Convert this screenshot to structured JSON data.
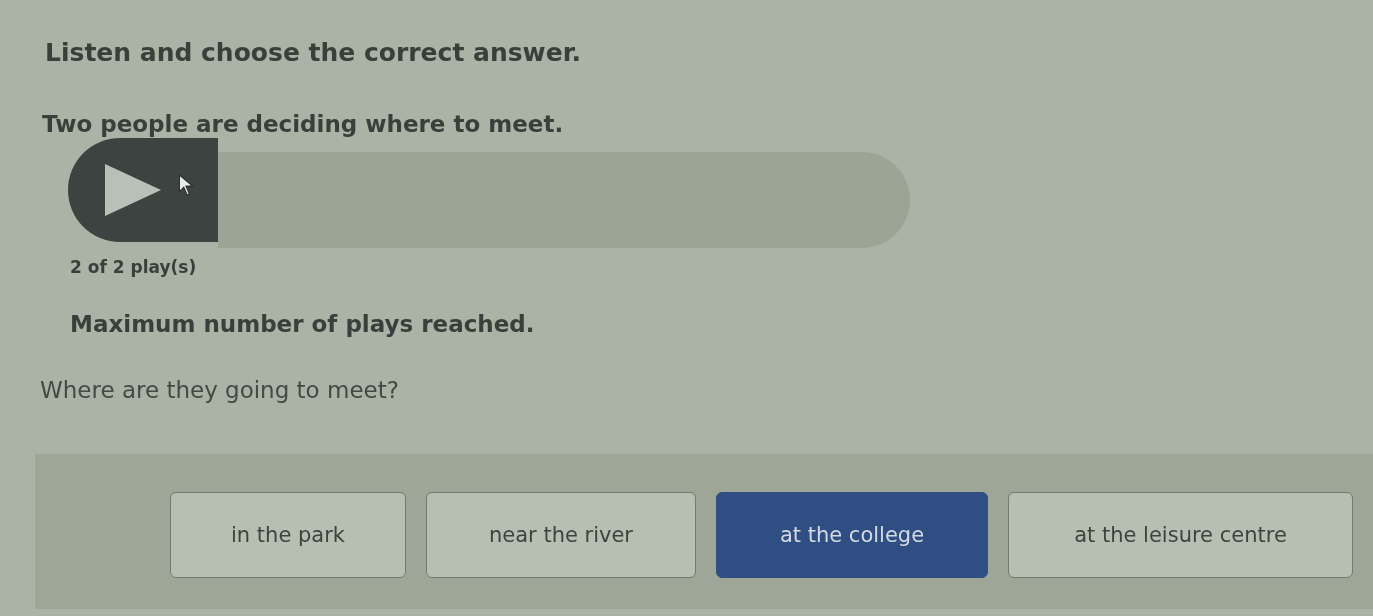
{
  "instruction": "Listen and choose the correct answer.",
  "context": "Two people are deciding where to meet.",
  "audio_player": {
    "play_count": "2 of 2 play(s)",
    "message": "Maximum number of plays reached."
  },
  "question": "Where are they going to meet?",
  "options": [
    {
      "label": "in the park",
      "selected": false
    },
    {
      "label": "near the river",
      "selected": false
    },
    {
      "label": "at the college",
      "selected": true
    },
    {
      "label": "at the leisure centre",
      "selected": false
    }
  ]
}
